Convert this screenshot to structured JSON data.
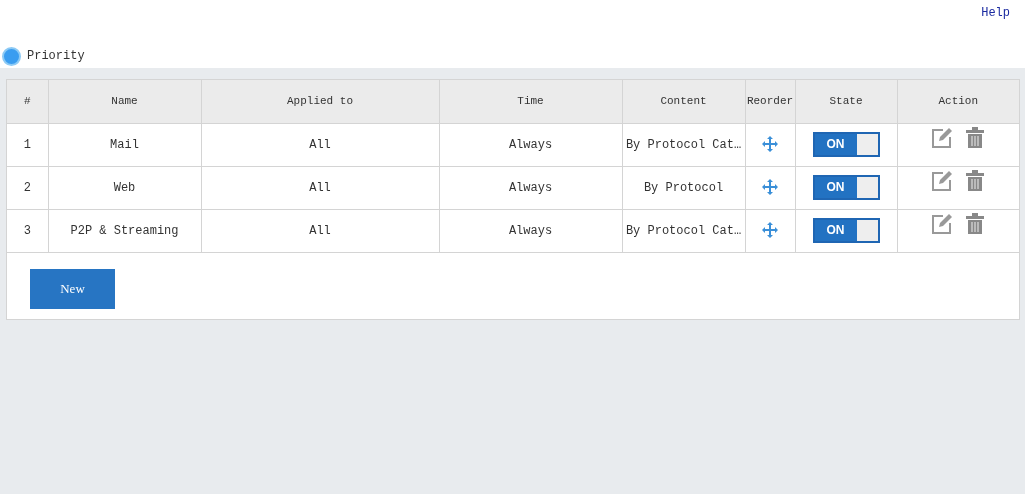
{
  "help_link": "Help",
  "section": {
    "title": "Priority"
  },
  "table": {
    "columns": [
      "#",
      "Name",
      "Applied to",
      "Time",
      "Content",
      "Reorder",
      "State",
      "Action"
    ],
    "rows": [
      {
        "index": "1",
        "name": "Mail",
        "applied_to": "All",
        "time": "Always",
        "content": "By Protocol Cat…",
        "state": {
          "on": true,
          "label": "ON"
        }
      },
      {
        "index": "2",
        "name": "Web",
        "applied_to": "All",
        "time": "Always",
        "content": "By Protocol",
        "state": {
          "on": true,
          "label": "ON"
        }
      },
      {
        "index": "3",
        "name": "P2P & Streaming",
        "applied_to": "All",
        "time": "Always",
        "content": "By Protocol Cat…",
        "state": {
          "on": true,
          "label": "ON"
        }
      }
    ]
  },
  "buttons": [
    "New"
  ]
}
